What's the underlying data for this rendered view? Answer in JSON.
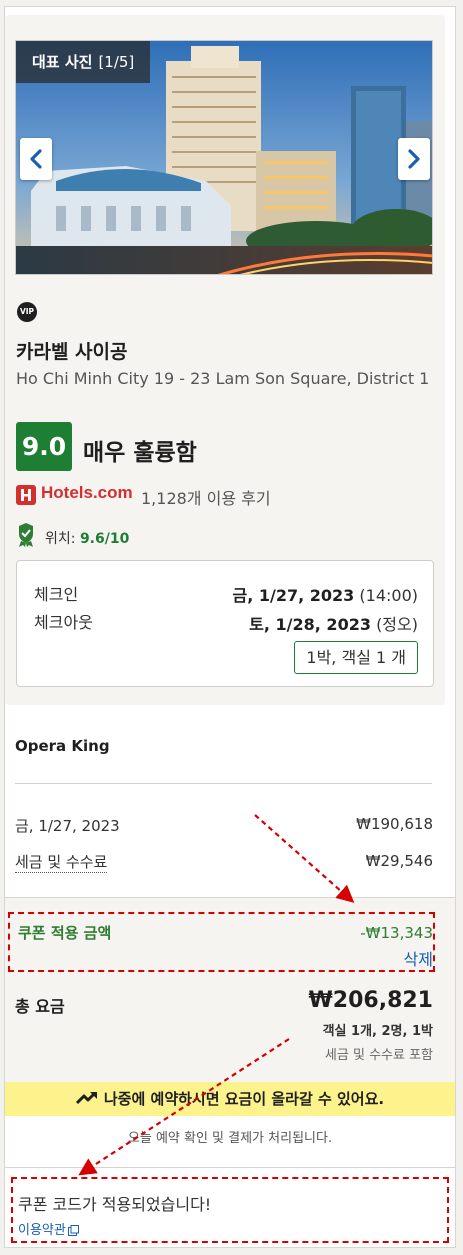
{
  "photo": {
    "tag_label": "대표 사진",
    "tag_count": "[1/5]"
  },
  "hotel": {
    "badge": "VIP",
    "name": "카라벨 사이공",
    "address": "Ho Chi Minh City 19 - 23 Lam Son Square, District 1"
  },
  "rating": {
    "score": "9.0",
    "label": "매우 훌륭함",
    "provider": "Hotels.com",
    "reviews": "1,128개 이용 후기",
    "location_label": "위치:",
    "location_score": "9.6/10"
  },
  "stay": {
    "checkin_label": "체크인",
    "checkin_date": "금, 1/27, 2023",
    "checkin_time": "(14:00)",
    "checkout_label": "체크아웃",
    "checkout_date": "토, 1/28, 2023",
    "checkout_time": "(정오)",
    "nights_rooms": "1박, 객실 1 개"
  },
  "room": {
    "name": "Opera King",
    "night_label": "금, 1/27, 2023",
    "night_price": "₩190,618",
    "tax_label": "세금 및 수수료",
    "tax_price": "₩29,546"
  },
  "coupon": {
    "label": "쿠폰 적용 금액",
    "amount": "-₩13,343",
    "delete": "삭제"
  },
  "total": {
    "label": "총 요금",
    "amount": "₩206,821",
    "detail": "객실 1개, 2명, 1박",
    "included": "세금 및 수수료 포함"
  },
  "notice": {
    "warning": "나중에 예약하시면 요금이 올라갈 수 있어요.",
    "confirm": "오늘 예약 확인 및 결제가 처리됩니다."
  },
  "applied": {
    "message": "쿠폰 코드가 적용되었습니다!",
    "terms": "이용약관"
  },
  "colors": {
    "score_green": "#1e7e34",
    "brand_red": "#d32f2f",
    "link_blue": "#1a5fb4",
    "annotation_red": "#d70000",
    "warning_yellow": "#fdf38d"
  }
}
